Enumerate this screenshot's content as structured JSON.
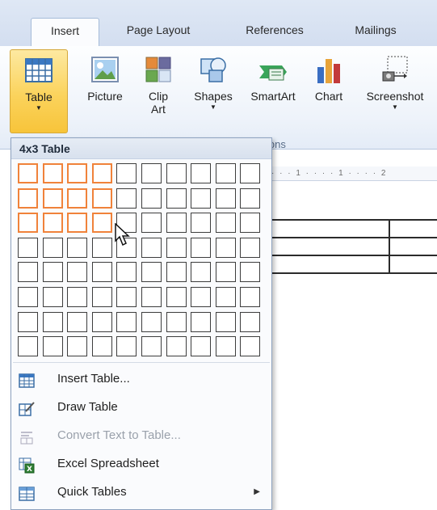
{
  "tabs": [
    {
      "label": "Insert",
      "active": true
    },
    {
      "label": "Page Layout",
      "active": false
    },
    {
      "label": "References",
      "active": false
    },
    {
      "label": "Mailings",
      "active": false
    }
  ],
  "ribbon": {
    "buttons": [
      {
        "label": "Table",
        "label2": "",
        "dropdown": true,
        "icon": "table-icon",
        "selected": true
      },
      {
        "label": "Picture",
        "label2": "",
        "dropdown": false,
        "icon": "picture-icon"
      },
      {
        "label": "Clip",
        "label2": "Art",
        "dropdown": false,
        "icon": "clip-art-icon"
      },
      {
        "label": "Shapes",
        "label2": "",
        "dropdown": true,
        "icon": "shapes-icon"
      },
      {
        "label": "SmartArt",
        "label2": "",
        "dropdown": false,
        "icon": "smartart-icon"
      },
      {
        "label": "Chart",
        "label2": "",
        "dropdown": false,
        "icon": "chart-icon"
      },
      {
        "label": "Screenshot",
        "label2": "",
        "dropdown": true,
        "icon": "screenshot-icon"
      }
    ],
    "group_label_partial": "ions"
  },
  "ruler": {
    "text": "· · · 1 · · · · 1 · · · · 2"
  },
  "dropdown": {
    "header": "4x3 Table",
    "grid": {
      "columns": 10,
      "rows": 8,
      "highlight_columns": 4,
      "highlight_rows": 3
    },
    "menu_items": [
      {
        "label": "Insert Table...",
        "icon": "insert-table-icon",
        "disabled": false,
        "submenu": false
      },
      {
        "label": "Draw Table",
        "icon": "draw-table-icon",
        "disabled": false,
        "submenu": false
      },
      {
        "label": "Convert Text to Table...",
        "icon": "convert-text-icon",
        "disabled": true,
        "submenu": false
      },
      {
        "label": "Excel Spreadsheet",
        "icon": "excel-icon",
        "disabled": false,
        "submenu": false
      },
      {
        "label": "Quick Tables",
        "icon": "quick-tables-icon",
        "disabled": false,
        "submenu": true
      }
    ]
  },
  "colors": {
    "highlight": "#f0823a",
    "selected_button": "#fbd35c",
    "ribbon_bg": "#eef3fa",
    "tab_bar_bg": "#dfe8f5"
  }
}
